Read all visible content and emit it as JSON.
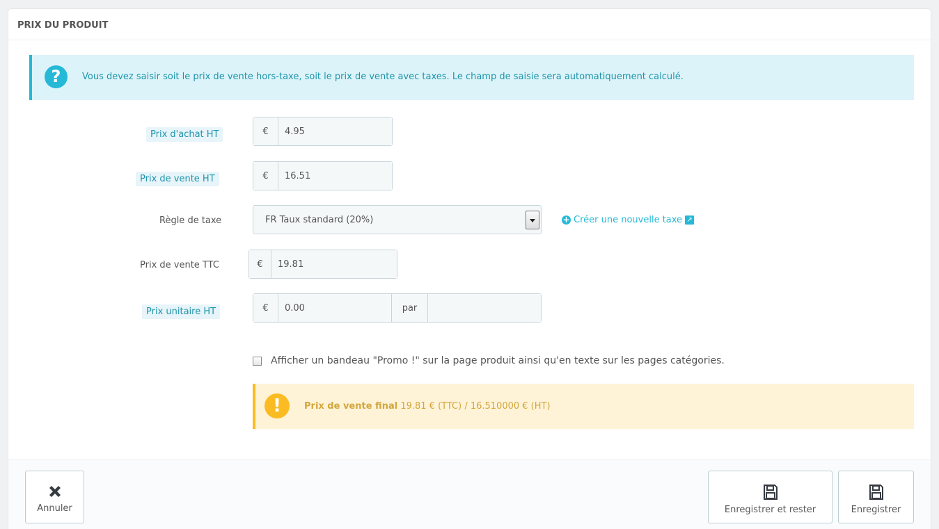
{
  "panel": {
    "title": "PRIX DU PRODUIT"
  },
  "info_alert": {
    "icon": "question-icon",
    "glyph": "?",
    "text": "Vous devez saisir soit le prix de vente hors-taxe, soit le prix de vente avec taxes. Le champ de saisie sera automatiquement calculé."
  },
  "fields": {
    "purchase_price": {
      "label": "Prix d'achat HT",
      "currency": "€",
      "value": "4.95"
    },
    "sale_price_ht": {
      "label": "Prix de vente HT",
      "currency": "€",
      "value": "16.51"
    },
    "tax_rule": {
      "label": "Règle de taxe",
      "value": "FR Taux standard (20%)"
    },
    "sale_price_ttc": {
      "label": "Prix de vente TTC",
      "currency": "€",
      "value": "19.81"
    },
    "unit_price": {
      "label": "Prix unitaire HT",
      "currency": "€",
      "value": "0.00",
      "per": "par",
      "unit": ""
    }
  },
  "create_tax_link": "Créer une nouvelle taxe",
  "promo_checkbox": {
    "label": "Afficher un bandeau \"Promo !\" sur la page produit ainsi qu'en texte sur les pages catégories.",
    "checked": false
  },
  "final_price_alert": {
    "glyph": "!",
    "label": "Prix de vente final",
    "value": "19.81 € (TTC) / 16.510000 € (HT)"
  },
  "footer": {
    "cancel": "Annuler",
    "save_stay": "Enregistrer et rester",
    "save": "Enregistrer"
  }
}
